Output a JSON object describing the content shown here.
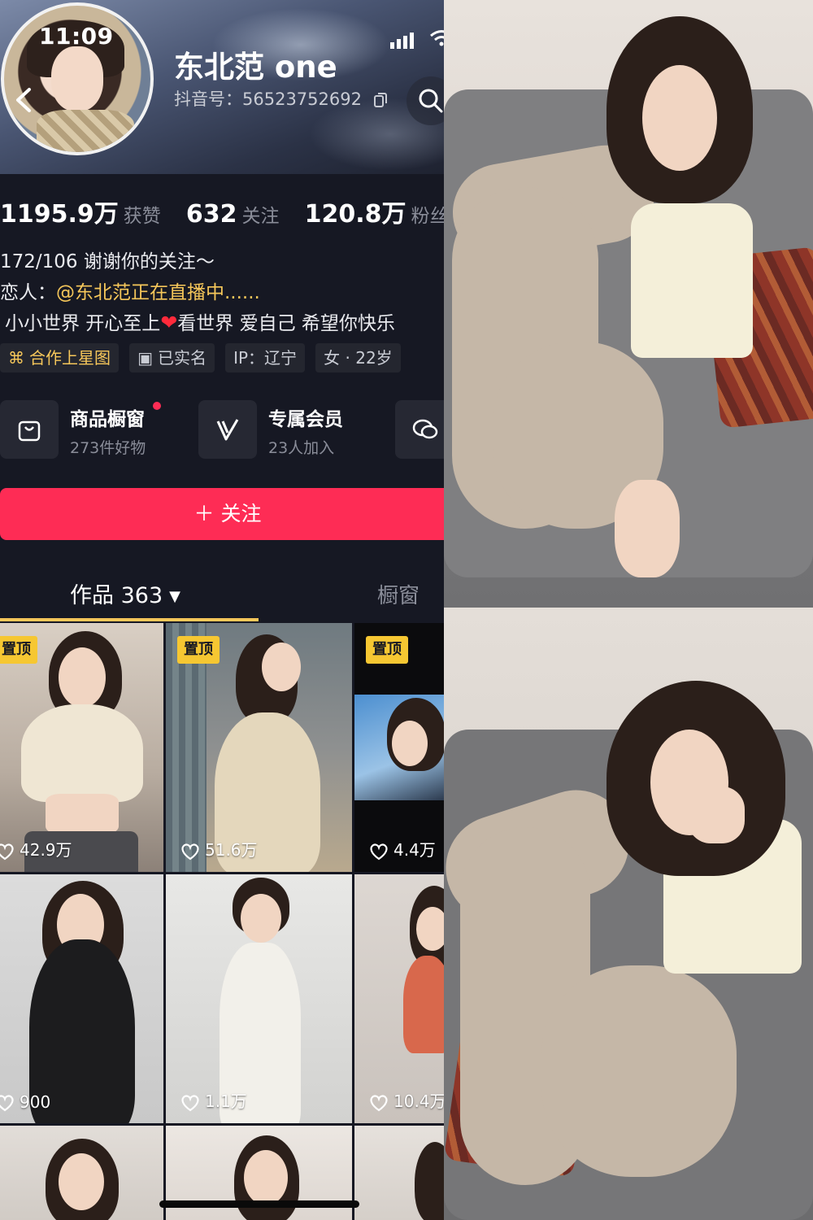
{
  "status_bar": {
    "time": "11:09"
  },
  "profile": {
    "username": "东北范 one",
    "douyin_id": "抖音号：56523752692",
    "stats": [
      {
        "value": "1195.9万",
        "label": "获赞"
      },
      {
        "value": "632",
        "label": "关注"
      },
      {
        "value": "120.8万",
        "label": "粉丝"
      }
    ],
    "bio": {
      "line1": "172/106  谢谢你的关注～",
      "line2_prefix": "恋人：",
      "line2_mention": "@东北范正在直播中......",
      "line3_a": "小小世界  开心至上",
      "line3_b": "看世界 爱自己 希望你快乐"
    },
    "tags": [
      "合作上星图",
      "已实名",
      "IP：辽宁",
      "女 · 22岁"
    ],
    "shop_card": {
      "title": "商品橱窗",
      "sub": "273件好物"
    },
    "member_card": {
      "title": "专属会员",
      "sub": "23人加入"
    },
    "follow_button": "＋ 关注",
    "tabs": {
      "works": "作品 363",
      "shop": "橱窗"
    }
  },
  "grid": [
    {
      "pinned": true,
      "pin_label": "置顶",
      "likes": "42.9万"
    },
    {
      "pinned": true,
      "pin_label": "置顶",
      "likes": "51.6万"
    },
    {
      "pinned": true,
      "pin_label": "置顶",
      "likes": "4.4万"
    },
    {
      "pinned": false,
      "likes": "900"
    },
    {
      "pinned": false,
      "likes": "1.1万"
    },
    {
      "pinned": false,
      "likes": "10.4万"
    }
  ],
  "colors": {
    "background": "#161823",
    "accent_red": "#fe2c55",
    "accent_yellow": "#f6c75a",
    "muted_text": "#8a8d99"
  },
  "icons": [
    "back-icon",
    "signal-icon",
    "wifi-icon",
    "copy-icon",
    "search-icon",
    "star-map-icon",
    "id-card-icon",
    "shop-bag-icon",
    "vip-icon",
    "chat-icon",
    "heart-icon"
  ]
}
